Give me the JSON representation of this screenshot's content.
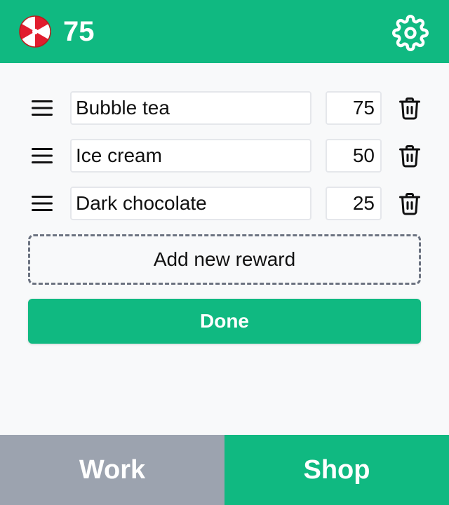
{
  "header": {
    "balance": "75",
    "candy_icon": "peppermint-candy-icon",
    "settings_icon": "gear-icon"
  },
  "rewards": [
    {
      "name": "Bubble tea",
      "cost": "75"
    },
    {
      "name": "Ice cream",
      "cost": "50"
    },
    {
      "name": "Dark chocolate",
      "cost": "25"
    }
  ],
  "actions": {
    "add_label": "Add new reward",
    "done_label": "Done"
  },
  "tabs": [
    {
      "label": "Work",
      "active": false
    },
    {
      "label": "Shop",
      "active": true
    }
  ],
  "colors": {
    "accent": "#10b981",
    "inactive_tab": "#9ca3af",
    "background": "#f8f9fa"
  }
}
